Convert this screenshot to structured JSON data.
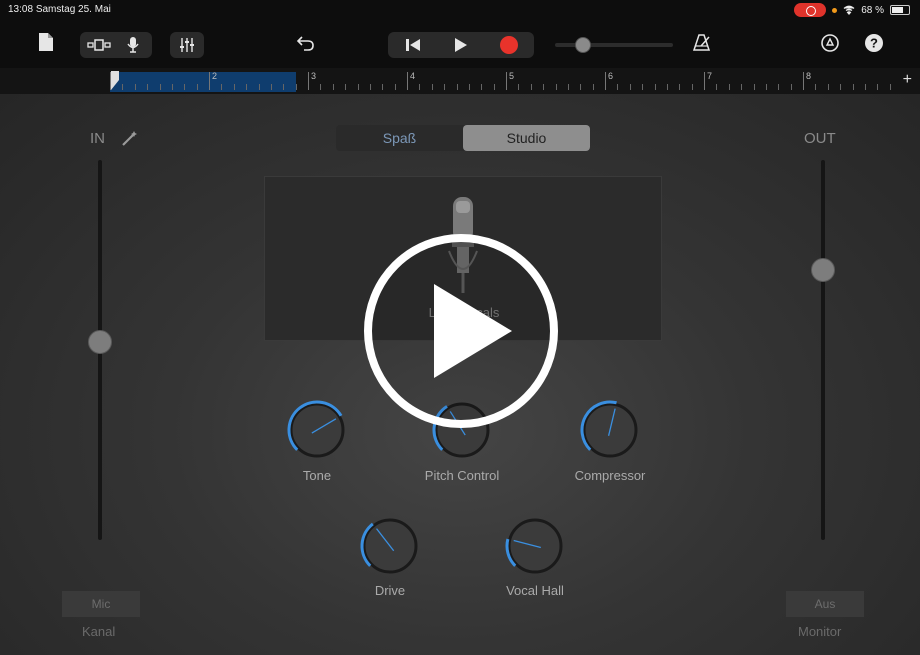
{
  "status": {
    "time": "13:08",
    "date": "Samstag 25. Mai",
    "battery": "68 %"
  },
  "ruler": {
    "bars": [
      "1",
      "2",
      "3",
      "4",
      "5",
      "6",
      "7",
      "8"
    ]
  },
  "input": {
    "label": "IN",
    "level": 0.48
  },
  "output": {
    "label": "OUT",
    "level": 0.29
  },
  "mode_tabs": {
    "left": "Spaß",
    "right": "Studio",
    "selected": "Studio"
  },
  "preset": {
    "name": "Lead Vocals",
    "icon": "microphone-icon"
  },
  "knobs": {
    "tone": {
      "label": "Tone",
      "value": 0.72
    },
    "pitch": {
      "label": "Pitch Control",
      "value": 0.38
    },
    "compressor": {
      "label": "Compressor",
      "value": 0.55
    },
    "drive": {
      "label": "Drive",
      "value": 0.36
    },
    "vocal_hall": {
      "label": "Vocal Hall",
      "value": 0.22
    }
  },
  "bottom": {
    "channel_button": "Mic",
    "channel_caption": "Kanal",
    "monitor_button": "Aus",
    "monitor_caption": "Monitor"
  },
  "colors": {
    "accent": "#3a8fe0",
    "record": "#e8332b",
    "ruler_selection": "#0f3d6e"
  }
}
